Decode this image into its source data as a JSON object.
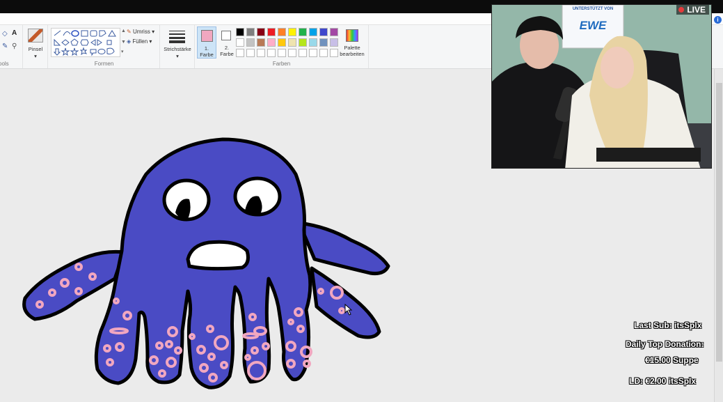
{
  "ribbon": {
    "tools_group_label": "Tools",
    "brush_label": "Pinsel",
    "shapes_group_label": "Formen",
    "outline_label": "Umriss",
    "fill_label": "Füllen",
    "stroke_label": "Strichstärke",
    "color1_label": "1.\nFarbe",
    "color2_label": "2.\nFarbe",
    "colors_group_label": "Farben",
    "edit_palette_label": "Palette\nbearbeiten",
    "color1_value": "#f1a7c0",
    "color2_value": "#ffffff",
    "palette_row1": [
      "#000000",
      "#7f7f7f",
      "#880015",
      "#ed1c24",
      "#ff7f27",
      "#fff200",
      "#22b14c",
      "#00a2e8",
      "#3f48cc",
      "#a349a4"
    ],
    "palette_row2": [
      "#ffffff",
      "#c3c3c3",
      "#b97a57",
      "#ffaec9",
      "#ffc90e",
      "#efe4b0",
      "#b5e61d",
      "#99d9ea",
      "#7092be",
      "#c8bfe7"
    ],
    "palette_row3": [
      "#ffffff",
      "#ffffff",
      "#ffffff",
      "#ffffff",
      "#ffffff",
      "#ffffff",
      "#ffffff",
      "#ffffff",
      "#ffffff",
      "#ffffff"
    ]
  },
  "webcam": {
    "sign_line1": "UNTERSTÜTZT VON",
    "sign_line2": "EWE",
    "live_label": "LIVE"
  },
  "stream_overlay": {
    "last_sub": "Last Sub: itsSplx",
    "daily_top_donation_label": "Daily Top Donation:",
    "daily_top_donation_value": "€15.00 Suppe",
    "ld": "LD:  €2.00 itsSplx"
  },
  "colors": {
    "octopus_fill": "#4a4bc4",
    "spots": "#f1a7c0",
    "outline": "#000000"
  }
}
